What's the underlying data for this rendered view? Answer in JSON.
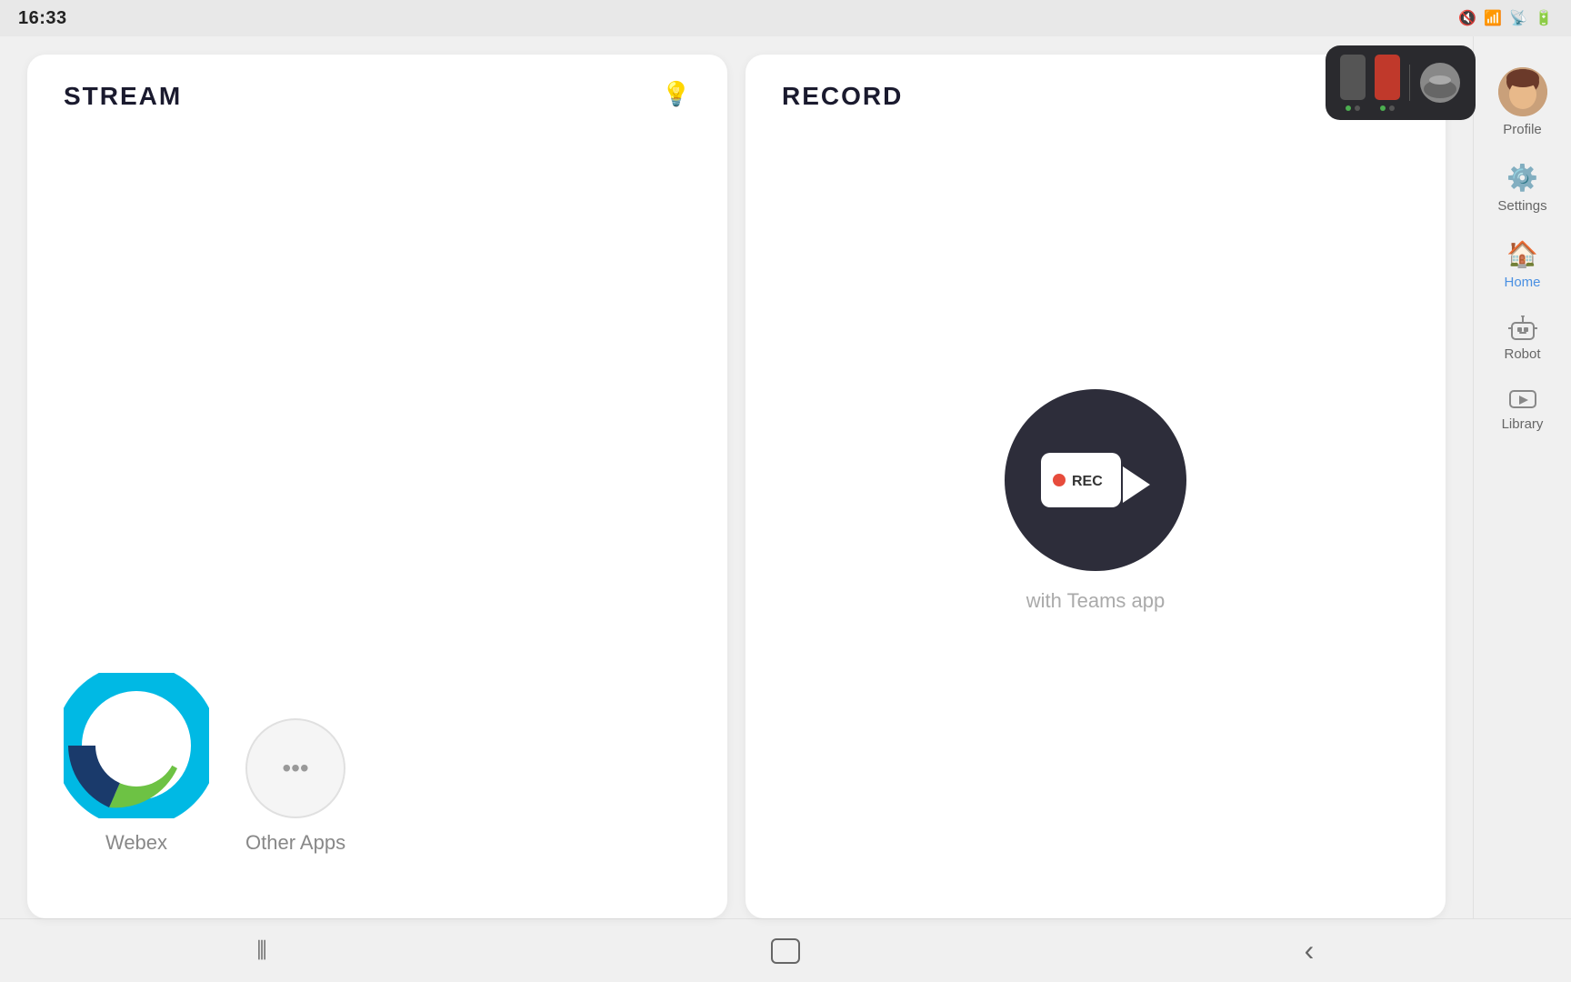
{
  "statusBar": {
    "time": "16:33",
    "icons": [
      "mute",
      "wifi",
      "signal",
      "battery"
    ]
  },
  "deviceWidget": {
    "visible": true
  },
  "streamCard": {
    "title": "STREAM",
    "apps": [
      {
        "id": "webex",
        "label": "Webex"
      },
      {
        "id": "other",
        "label": "Other Apps"
      }
    ]
  },
  "recordCard": {
    "title": "RECORD",
    "subtitle": "with Teams app"
  },
  "sidebar": {
    "items": [
      {
        "id": "profile",
        "label": "Profile",
        "active": false
      },
      {
        "id": "settings",
        "label": "Settings",
        "active": false
      },
      {
        "id": "home",
        "label": "Home",
        "active": true
      },
      {
        "id": "robot",
        "label": "Robot",
        "active": false
      },
      {
        "id": "library",
        "label": "Library",
        "active": false
      }
    ]
  },
  "bottomNav": {
    "items": [
      {
        "id": "menu",
        "icon": "|||"
      },
      {
        "id": "home",
        "icon": "⬜"
      },
      {
        "id": "back",
        "icon": "‹"
      }
    ]
  }
}
